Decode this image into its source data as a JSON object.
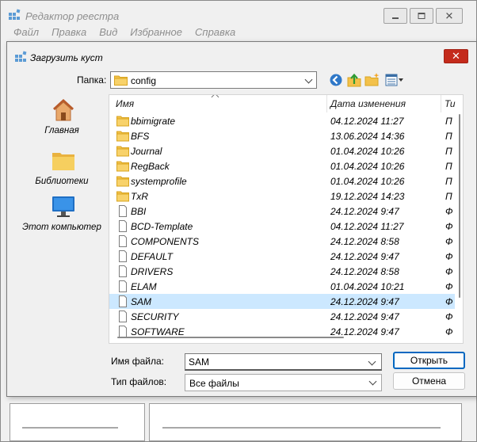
{
  "background_window": {
    "title": "Редактор реестра",
    "menu": [
      "Файл",
      "Правка",
      "Вид",
      "Избранное",
      "Справка"
    ]
  },
  "dialog": {
    "title": "Загрузить куст",
    "look_in_label": "Папка:",
    "look_in_value": "config",
    "places": [
      {
        "label": "Главная",
        "icon": "home-icon"
      },
      {
        "label": "Библиотеки",
        "icon": "libraries-folder-icon"
      },
      {
        "label": "Этот компьютер",
        "icon": "computer-monitor-icon"
      }
    ],
    "columns": {
      "name": "Имя",
      "date": "Дата изменения",
      "type": "Ти"
    },
    "files": [
      {
        "name": "bbimigrate",
        "date": "04.12.2024 11:27",
        "type": "П",
        "kind": "folder"
      },
      {
        "name": "BFS",
        "date": "13.06.2024 14:36",
        "type": "П",
        "kind": "folder"
      },
      {
        "name": "Journal",
        "date": "01.04.2024 10:26",
        "type": "П",
        "kind": "folder"
      },
      {
        "name": "RegBack",
        "date": "01.04.2024 10:26",
        "type": "П",
        "kind": "folder"
      },
      {
        "name": "systemprofile",
        "date": "01.04.2024 10:26",
        "type": "П",
        "kind": "folder"
      },
      {
        "name": "TxR",
        "date": "19.12.2024 14:23",
        "type": "П",
        "kind": "folder"
      },
      {
        "name": "BBI",
        "date": "24.12.2024 9:47",
        "type": "Ф",
        "kind": "file"
      },
      {
        "name": "BCD-Template",
        "date": "04.12.2024 11:27",
        "type": "Ф",
        "kind": "file"
      },
      {
        "name": "COMPONENTS",
        "date": "24.12.2024 8:58",
        "type": "Ф",
        "kind": "file"
      },
      {
        "name": "DEFAULT",
        "date": "24.12.2024 9:47",
        "type": "Ф",
        "kind": "file"
      },
      {
        "name": "DRIVERS",
        "date": "24.12.2024 8:58",
        "type": "Ф",
        "kind": "file"
      },
      {
        "name": "ELAM",
        "date": "01.04.2024 10:21",
        "type": "Ф",
        "kind": "file"
      },
      {
        "name": "SAM",
        "date": "24.12.2024 9:47",
        "type": "Ф",
        "kind": "file",
        "selected": true
      },
      {
        "name": "SECURITY",
        "date": "24.12.2024 9:47",
        "type": "Ф",
        "kind": "file"
      },
      {
        "name": "SOFTWARE",
        "date": "24.12.2024 9:47",
        "type": "Ф",
        "kind": "file"
      }
    ],
    "file_name_label": "Имя файла:",
    "file_name_value": "SAM",
    "file_type_label": "Тип файлов:",
    "file_type_value": "Все файлы",
    "open_button": "Открыть",
    "cancel_button": "Отмена"
  },
  "colors": {
    "selection": "#cce8ff",
    "accent": "#0067c0",
    "close_red": "#c42b1c",
    "folder_yellow": "#f3c14a"
  }
}
